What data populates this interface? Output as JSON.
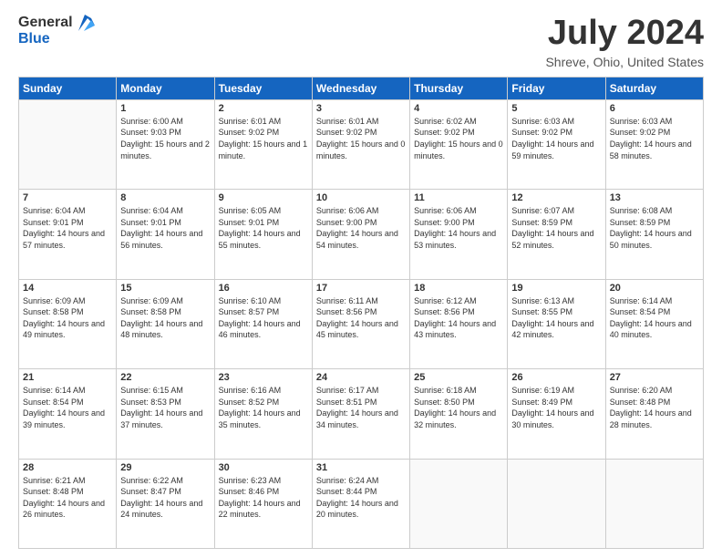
{
  "header": {
    "logo_general": "General",
    "logo_blue": "Blue",
    "month_year": "July 2024",
    "location": "Shreve, Ohio, United States"
  },
  "days_of_week": [
    "Sunday",
    "Monday",
    "Tuesday",
    "Wednesday",
    "Thursday",
    "Friday",
    "Saturday"
  ],
  "weeks": [
    [
      {
        "day": null,
        "info": null
      },
      {
        "day": "1",
        "sunrise": "6:00 AM",
        "sunset": "9:03 PM",
        "daylight": "15 hours and 2 minutes."
      },
      {
        "day": "2",
        "sunrise": "6:01 AM",
        "sunset": "9:02 PM",
        "daylight": "15 hours and 1 minute."
      },
      {
        "day": "3",
        "sunrise": "6:01 AM",
        "sunset": "9:02 PM",
        "daylight": "15 hours and 0 minutes."
      },
      {
        "day": "4",
        "sunrise": "6:02 AM",
        "sunset": "9:02 PM",
        "daylight": "15 hours and 0 minutes."
      },
      {
        "day": "5",
        "sunrise": "6:03 AM",
        "sunset": "9:02 PM",
        "daylight": "14 hours and 59 minutes."
      },
      {
        "day": "6",
        "sunrise": "6:03 AM",
        "sunset": "9:02 PM",
        "daylight": "14 hours and 58 minutes."
      }
    ],
    [
      {
        "day": "7",
        "sunrise": "6:04 AM",
        "sunset": "9:01 PM",
        "daylight": "14 hours and 57 minutes."
      },
      {
        "day": "8",
        "sunrise": "6:04 AM",
        "sunset": "9:01 PM",
        "daylight": "14 hours and 56 minutes."
      },
      {
        "day": "9",
        "sunrise": "6:05 AM",
        "sunset": "9:01 PM",
        "daylight": "14 hours and 55 minutes."
      },
      {
        "day": "10",
        "sunrise": "6:06 AM",
        "sunset": "9:00 PM",
        "daylight": "14 hours and 54 minutes."
      },
      {
        "day": "11",
        "sunrise": "6:06 AM",
        "sunset": "9:00 PM",
        "daylight": "14 hours and 53 minutes."
      },
      {
        "day": "12",
        "sunrise": "6:07 AM",
        "sunset": "8:59 PM",
        "daylight": "14 hours and 52 minutes."
      },
      {
        "day": "13",
        "sunrise": "6:08 AM",
        "sunset": "8:59 PM",
        "daylight": "14 hours and 50 minutes."
      }
    ],
    [
      {
        "day": "14",
        "sunrise": "6:09 AM",
        "sunset": "8:58 PM",
        "daylight": "14 hours and 49 minutes."
      },
      {
        "day": "15",
        "sunrise": "6:09 AM",
        "sunset": "8:58 PM",
        "daylight": "14 hours and 48 minutes."
      },
      {
        "day": "16",
        "sunrise": "6:10 AM",
        "sunset": "8:57 PM",
        "daylight": "14 hours and 46 minutes."
      },
      {
        "day": "17",
        "sunrise": "6:11 AM",
        "sunset": "8:56 PM",
        "daylight": "14 hours and 45 minutes."
      },
      {
        "day": "18",
        "sunrise": "6:12 AM",
        "sunset": "8:56 PM",
        "daylight": "14 hours and 43 minutes."
      },
      {
        "day": "19",
        "sunrise": "6:13 AM",
        "sunset": "8:55 PM",
        "daylight": "14 hours and 42 minutes."
      },
      {
        "day": "20",
        "sunrise": "6:14 AM",
        "sunset": "8:54 PM",
        "daylight": "14 hours and 40 minutes."
      }
    ],
    [
      {
        "day": "21",
        "sunrise": "6:14 AM",
        "sunset": "8:54 PM",
        "daylight": "14 hours and 39 minutes."
      },
      {
        "day": "22",
        "sunrise": "6:15 AM",
        "sunset": "8:53 PM",
        "daylight": "14 hours and 37 minutes."
      },
      {
        "day": "23",
        "sunrise": "6:16 AM",
        "sunset": "8:52 PM",
        "daylight": "14 hours and 35 minutes."
      },
      {
        "day": "24",
        "sunrise": "6:17 AM",
        "sunset": "8:51 PM",
        "daylight": "14 hours and 34 minutes."
      },
      {
        "day": "25",
        "sunrise": "6:18 AM",
        "sunset": "8:50 PM",
        "daylight": "14 hours and 32 minutes."
      },
      {
        "day": "26",
        "sunrise": "6:19 AM",
        "sunset": "8:49 PM",
        "daylight": "14 hours and 30 minutes."
      },
      {
        "day": "27",
        "sunrise": "6:20 AM",
        "sunset": "8:48 PM",
        "daylight": "14 hours and 28 minutes."
      }
    ],
    [
      {
        "day": "28",
        "sunrise": "6:21 AM",
        "sunset": "8:48 PM",
        "daylight": "14 hours and 26 minutes."
      },
      {
        "day": "29",
        "sunrise": "6:22 AM",
        "sunset": "8:47 PM",
        "daylight": "14 hours and 24 minutes."
      },
      {
        "day": "30",
        "sunrise": "6:23 AM",
        "sunset": "8:46 PM",
        "daylight": "14 hours and 22 minutes."
      },
      {
        "day": "31",
        "sunrise": "6:24 AM",
        "sunset": "8:44 PM",
        "daylight": "14 hours and 20 minutes."
      },
      {
        "day": null,
        "info": null
      },
      {
        "day": null,
        "info": null
      },
      {
        "day": null,
        "info": null
      }
    ]
  ]
}
